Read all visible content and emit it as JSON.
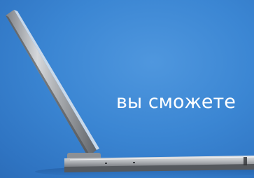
{
  "caption": {
    "text": "вы сможете"
  },
  "colors": {
    "background_light": "#4f97de",
    "background_dark": "#255fa6",
    "caption": "#ffffff",
    "laptop_metal": "#b9bcc0",
    "laptop_dark": "#5a5d62"
  },
  "laptop_icon": "open-laptop"
}
